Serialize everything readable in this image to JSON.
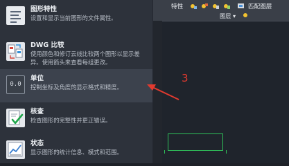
{
  "menu": {
    "items": [
      {
        "title": "图形特性",
        "description": "设置和显示当前图形的文件属性。",
        "icon": "drawing-properties-icon"
      },
      {
        "title": "DWG 比较",
        "description": "使用颜色和修订云线比较两个图形以显示差异。使用箭头来查看每组更改。",
        "icon": "dwg-compare-icon"
      },
      {
        "title": "单位",
        "description": "控制坐标及角度的显示格式和精度。",
        "icon": "units-icon",
        "icon_text": "0.0",
        "active": true
      },
      {
        "title": "核查",
        "description": "检查图形的完整性并更正错误。",
        "icon": "audit-check-icon"
      },
      {
        "title": "状态",
        "description": "显示图形的统计信息、模式和范围。",
        "icon": "status-icon"
      }
    ]
  },
  "ribbon": {
    "properties_label": "特性",
    "match_properties_label": "匹配图层",
    "layers_panel_label": "图层 ▾"
  },
  "annotation": {
    "step_number": "3",
    "color": "#e23a2f"
  },
  "colors": {
    "panel_bg": "#2d323b",
    "active_item_bg": "#3c424d",
    "canvas_bg": "#1f242c",
    "drawing_green": "#2fc35a"
  }
}
